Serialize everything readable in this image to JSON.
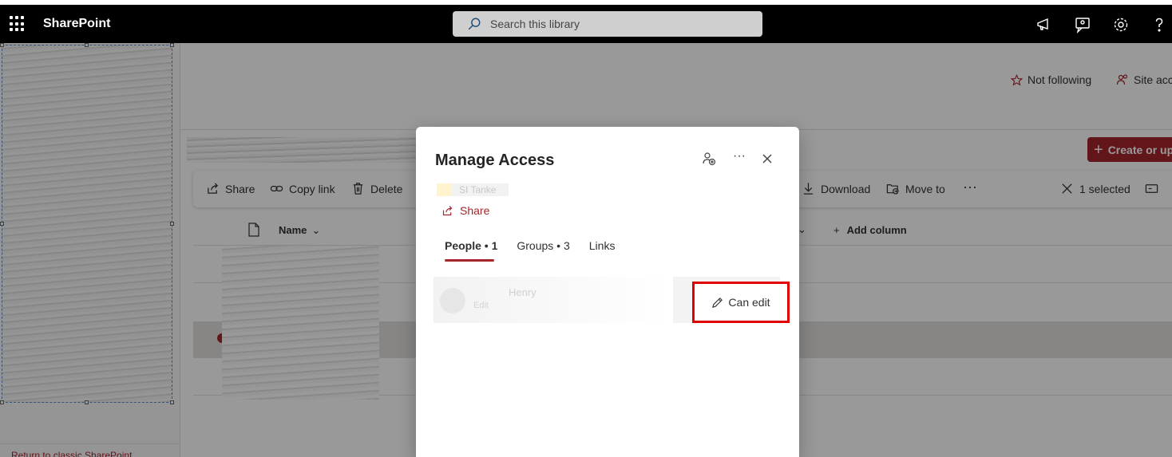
{
  "suite_bar": {
    "app_name": "SharePoint",
    "search_placeholder": "Search this library"
  },
  "site_header": {
    "follow_label": "Not following",
    "site_access_label": "Site acc",
    "create_button_label": "Create or up"
  },
  "command_bar": {
    "share": "Share",
    "copy_link": "Copy link",
    "delete": "Delete",
    "download": "Download",
    "move_to": "Move to",
    "selected_count": "1 selected"
  },
  "list": {
    "name_column": "Name",
    "add_column": "Add column"
  },
  "left_nav": {
    "return_link": "Return to classic SharePoint"
  },
  "dialog": {
    "title": "Manage Access",
    "item_name": "SI Tanke",
    "share_label": "Share",
    "tabs": [
      {
        "label": "People • 1"
      },
      {
        "label": "Groups • 3"
      },
      {
        "label": "Links"
      }
    ],
    "person": {
      "name": "Henry",
      "sub": "Edit"
    },
    "permission_label": "Can edit"
  },
  "colors": {
    "accent": "#a4262c",
    "highlight_border": "#e00000",
    "suite_bar": "#000000"
  }
}
